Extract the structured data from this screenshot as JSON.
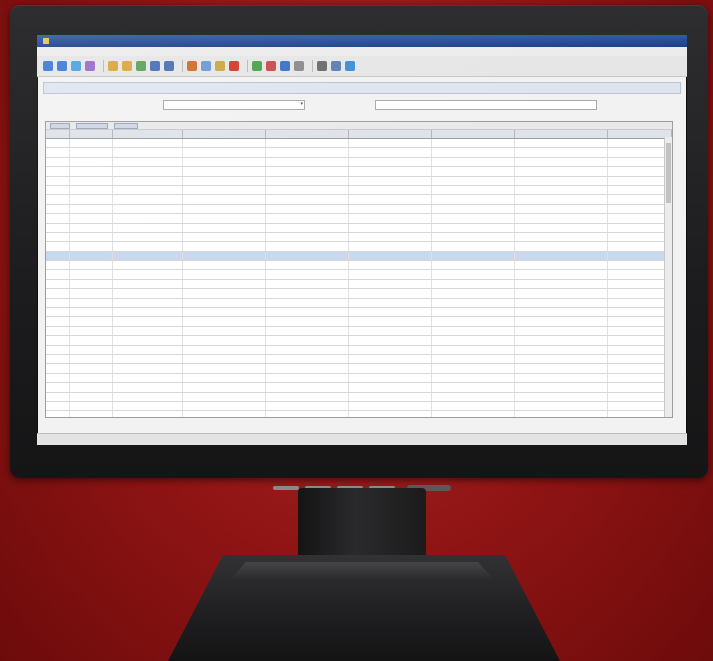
{
  "colors": {
    "background": "#8f1414",
    "bezel": "#1c1c1e",
    "titlebar": "#1b3f86",
    "selected_row": "#c7d8ef"
  },
  "toolbar": {
    "icons": [
      {
        "name": "back-icon",
        "color": "#3a7bd5"
      },
      {
        "name": "forward-icon",
        "color": "#3a7bd5"
      },
      {
        "name": "refresh-icon",
        "color": "#4aa3df"
      },
      {
        "name": "filter-icon",
        "color": "#9b6bcc"
      },
      {
        "name": "save-icon",
        "color": "#d9a63a"
      },
      {
        "name": "save-all-icon",
        "color": "#d9a63a"
      },
      {
        "name": "export-icon",
        "color": "#5aa35a"
      },
      {
        "name": "chart-icon",
        "color": "#4a6fb5"
      },
      {
        "name": "table-icon",
        "color": "#4a6fb5"
      },
      {
        "name": "edit-icon",
        "color": "#d06a2a"
      },
      {
        "name": "copy-icon",
        "color": "#6a9ad0"
      },
      {
        "name": "lock-icon",
        "color": "#c9a640"
      },
      {
        "name": "delete-icon",
        "color": "#d33a2a"
      },
      {
        "name": "check-icon",
        "color": "#4aa34a"
      },
      {
        "name": "flag-icon",
        "color": "#c94a4a"
      },
      {
        "name": "info-icon",
        "color": "#3a6fc9"
      },
      {
        "name": "document-icon",
        "color": "#8a8a8a"
      },
      {
        "name": "print-icon",
        "color": "#6a6a6a"
      },
      {
        "name": "settings-icon",
        "color": "#5a7fb5"
      },
      {
        "name": "help-icon",
        "color": "#3a8fd5"
      }
    ]
  }
}
